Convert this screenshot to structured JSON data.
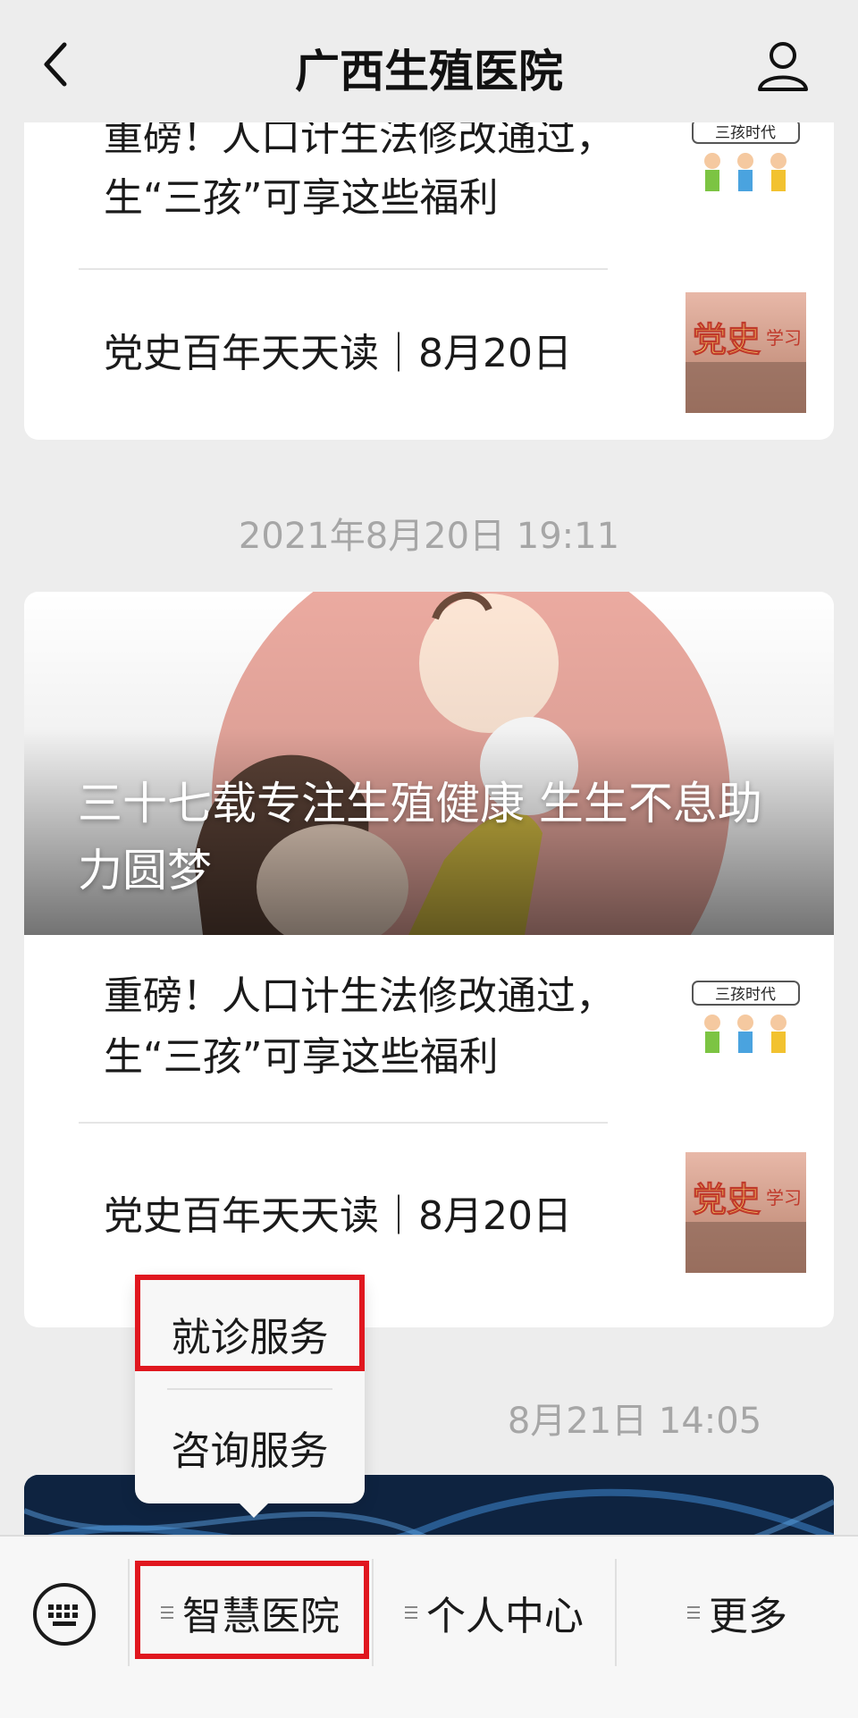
{
  "header": {
    "title": "广西生殖医院",
    "back_icon": "chevron-left-icon",
    "user_icon": "user-icon"
  },
  "articles_prev": [
    {
      "title": "重磅！人口计生法修改通过，生“三孩”可享这些福利",
      "thumb_label": "三孩时代"
    },
    {
      "title": "党史百年天天读｜8月20日",
      "thumb_label_1": "党史",
      "thumb_label_2": "学习"
    }
  ],
  "timestamp_1": "2021年8月20日 19:11",
  "card_main": {
    "hero_title": "三十七载专注生殖健康  生生不息助力圆梦",
    "articles": [
      {
        "title": "重磅！人口计生法修改通过，生“三孩”可享这些福利",
        "thumb_label": "三孩时代"
      },
      {
        "title": "党史百年天天读｜8月20日",
        "thumb_label_1": "党史",
        "thumb_label_2": "学习"
      }
    ]
  },
  "timestamp_2": "8月21日 14:05",
  "popup_menu": {
    "items": [
      "就诊服务",
      "咨询服务"
    ],
    "highlighted": "就诊服务"
  },
  "bottom_menu": {
    "keyboard_icon": "keyboard-icon",
    "items": [
      "智慧医院",
      "个人中心",
      "更多"
    ],
    "highlighted": "智慧医院"
  },
  "colors": {
    "background": "#ededed",
    "card": "#ffffff",
    "highlight": "#e0171f",
    "timestamp": "#a6a6a6"
  }
}
